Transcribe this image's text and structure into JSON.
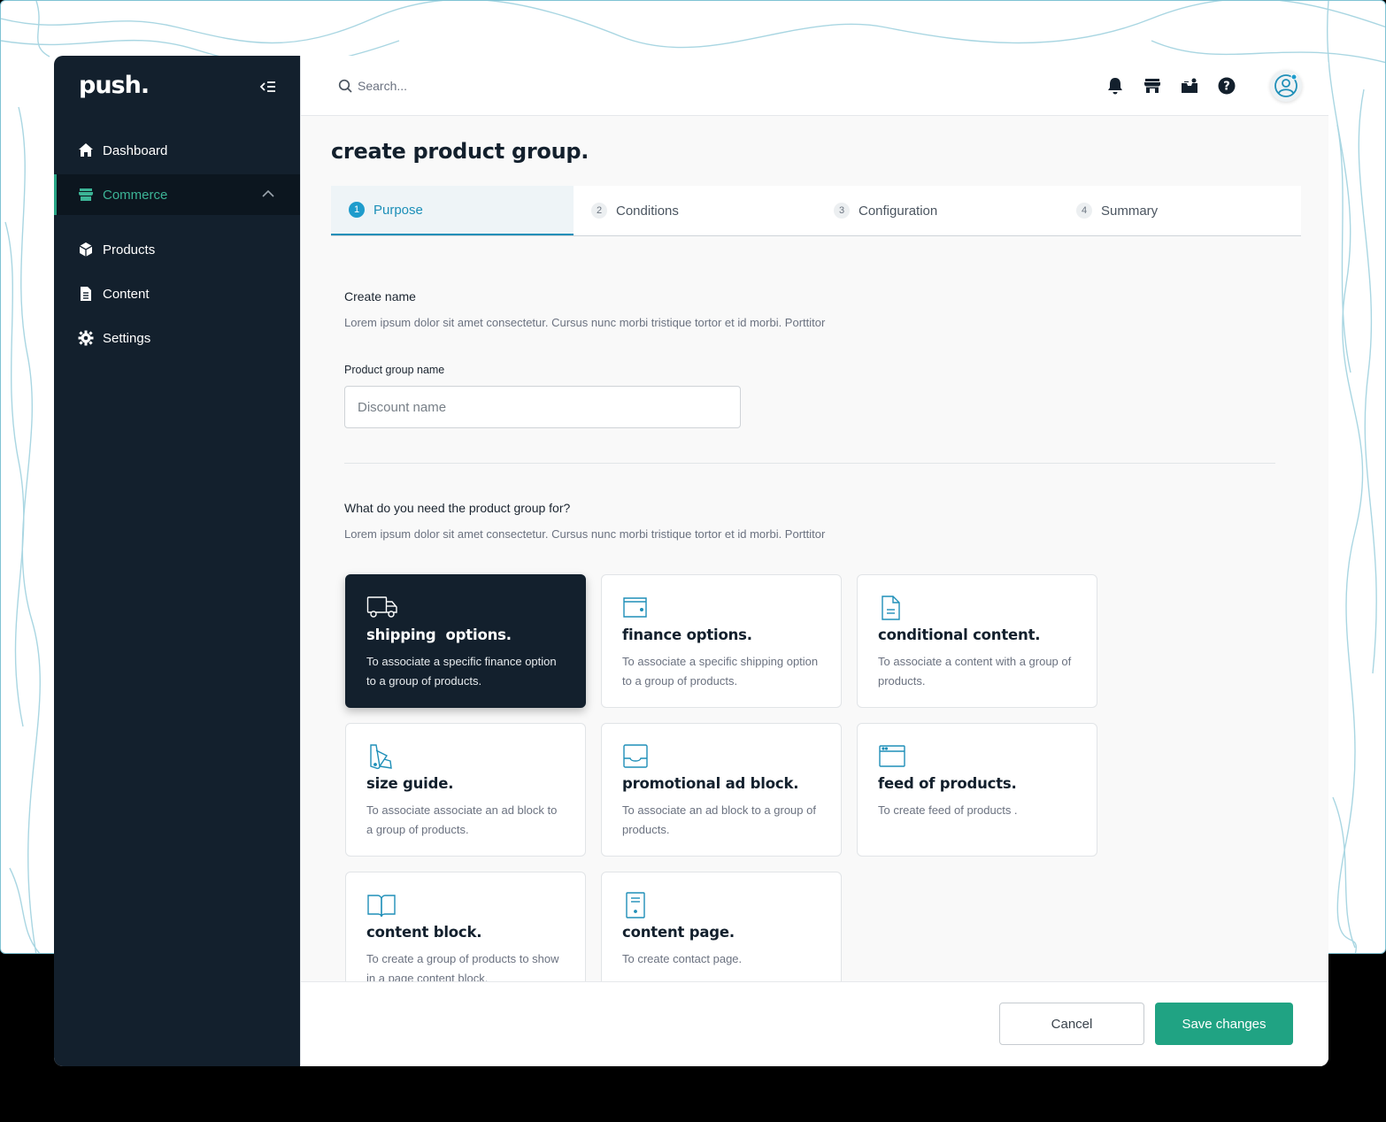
{
  "brand": {
    "logo_text": "push."
  },
  "colors": {
    "sidebar_bg": "#13202d",
    "accent_green": "#20a383",
    "accent_blue": "#1c8fb8"
  },
  "sidebar": {
    "items": [
      {
        "label": "Dashboard",
        "icon": "home-icon"
      },
      {
        "label": "Commerce",
        "icon": "store-icon",
        "active": true,
        "expanded": true
      },
      {
        "label": "Products",
        "icon": "cube-icon"
      },
      {
        "label": "Content",
        "icon": "document-icon"
      },
      {
        "label": "Settings",
        "icon": "gear-icon"
      }
    ]
  },
  "header": {
    "search_placeholder": "Search...",
    "icons": [
      "bell-icon",
      "store-icon",
      "inbox-icon",
      "help-icon",
      "user-avatar-icon"
    ]
  },
  "page": {
    "title": "create product group."
  },
  "steps": [
    {
      "num": "1",
      "label": "Purpose",
      "active": true
    },
    {
      "num": "2",
      "label": "Conditions"
    },
    {
      "num": "3",
      "label": "Configuration"
    },
    {
      "num": "4",
      "label": "Summary"
    }
  ],
  "name_section": {
    "title": "Create name",
    "description": "Lorem ipsum dolor sit amet consectetur. Cursus nunc morbi tristique tortor et id morbi. Porttitor",
    "field_label": "Product group name",
    "field_placeholder": "Discount name"
  },
  "purpose_section": {
    "title": "What do you need the product group for?",
    "description": "Lorem ipsum dolor sit amet consectetur. Cursus nunc morbi tristique tortor et id morbi. Porttitor"
  },
  "cards": [
    {
      "title": "shipping  options.",
      "description": "To associate a specific finance option to a group of products.",
      "icon": "truck-icon",
      "selected": true
    },
    {
      "title": "finance options.",
      "description": "To associate a specific shipping option to a group of products.",
      "icon": "wallet-icon"
    },
    {
      "title": "conditional content.",
      "description": "To associate a content with a group of products.",
      "icon": "file-icon"
    },
    {
      "title": "size guide.",
      "description": "To associate associate an ad block to a group of products.",
      "icon": "swatch-icon"
    },
    {
      "title": "promotional ad block.",
      "description": "To associate an ad block to a group of products.",
      "icon": "tray-icon"
    },
    {
      "title": "feed of products.",
      "description": "To create feed of  products .",
      "icon": "browser-icon"
    },
    {
      "title": "content block.",
      "description": "To create  a group of products to show in a page content block.",
      "icon": "book-icon"
    },
    {
      "title": "content page.",
      "description": "To create contact page.",
      "icon": "page-icon"
    }
  ],
  "footer": {
    "cancel_label": "Cancel",
    "save_label": "Save changes"
  }
}
